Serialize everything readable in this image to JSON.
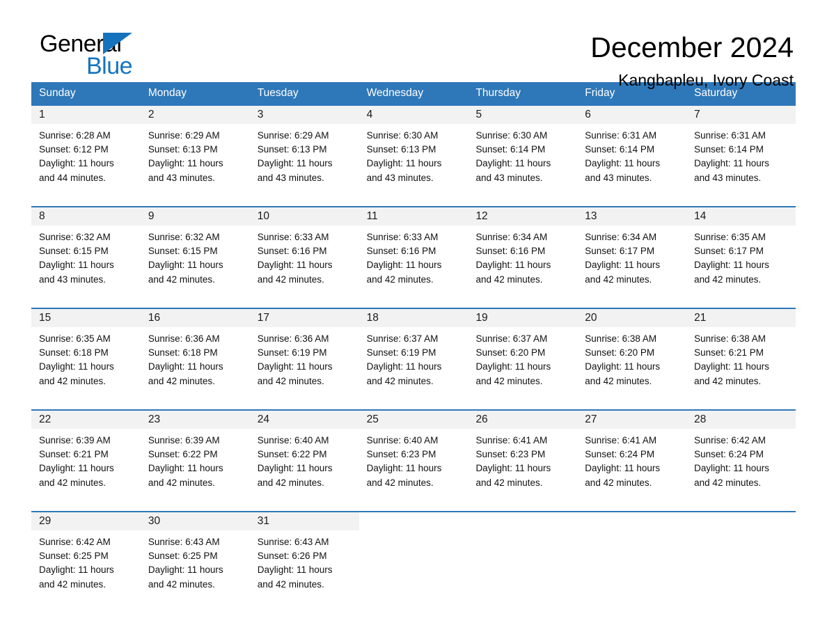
{
  "brand": {
    "name_part1": "General",
    "name_part2": "Blue",
    "accent_color": "#1573bd",
    "triangle_icon": "triangle-icon"
  },
  "header": {
    "month_title": "December 2024",
    "location": "Kangbapleu, Ivory Coast"
  },
  "calendar": {
    "header_color": "#2e77b8",
    "weekday_band_color": "#f2f2f2",
    "weekdays": [
      "Sunday",
      "Monday",
      "Tuesday",
      "Wednesday",
      "Thursday",
      "Friday",
      "Saturday"
    ],
    "weeks": [
      {
        "days": [
          {
            "num": "1",
            "text": "Sunrise: 6:28 AM\nSunset: 6:12 PM\nDaylight: 11 hours\nand 44 minutes."
          },
          {
            "num": "2",
            "text": "Sunrise: 6:29 AM\nSunset: 6:13 PM\nDaylight: 11 hours\nand 43 minutes."
          },
          {
            "num": "3",
            "text": "Sunrise: 6:29 AM\nSunset: 6:13 PM\nDaylight: 11 hours\nand 43 minutes."
          },
          {
            "num": "4",
            "text": "Sunrise: 6:30 AM\nSunset: 6:13 PM\nDaylight: 11 hours\nand 43 minutes."
          },
          {
            "num": "5",
            "text": "Sunrise: 6:30 AM\nSunset: 6:14 PM\nDaylight: 11 hours\nand 43 minutes."
          },
          {
            "num": "6",
            "text": "Sunrise: 6:31 AM\nSunset: 6:14 PM\nDaylight: 11 hours\nand 43 minutes."
          },
          {
            "num": "7",
            "text": "Sunrise: 6:31 AM\nSunset: 6:14 PM\nDaylight: 11 hours\nand 43 minutes."
          }
        ]
      },
      {
        "days": [
          {
            "num": "8",
            "text": "Sunrise: 6:32 AM\nSunset: 6:15 PM\nDaylight: 11 hours\nand 43 minutes."
          },
          {
            "num": "9",
            "text": "Sunrise: 6:32 AM\nSunset: 6:15 PM\nDaylight: 11 hours\nand 42 minutes."
          },
          {
            "num": "10",
            "text": "Sunrise: 6:33 AM\nSunset: 6:16 PM\nDaylight: 11 hours\nand 42 minutes."
          },
          {
            "num": "11",
            "text": "Sunrise: 6:33 AM\nSunset: 6:16 PM\nDaylight: 11 hours\nand 42 minutes."
          },
          {
            "num": "12",
            "text": "Sunrise: 6:34 AM\nSunset: 6:16 PM\nDaylight: 11 hours\nand 42 minutes."
          },
          {
            "num": "13",
            "text": "Sunrise: 6:34 AM\nSunset: 6:17 PM\nDaylight: 11 hours\nand 42 minutes."
          },
          {
            "num": "14",
            "text": "Sunrise: 6:35 AM\nSunset: 6:17 PM\nDaylight: 11 hours\nand 42 minutes."
          }
        ]
      },
      {
        "days": [
          {
            "num": "15",
            "text": "Sunrise: 6:35 AM\nSunset: 6:18 PM\nDaylight: 11 hours\nand 42 minutes."
          },
          {
            "num": "16",
            "text": "Sunrise: 6:36 AM\nSunset: 6:18 PM\nDaylight: 11 hours\nand 42 minutes."
          },
          {
            "num": "17",
            "text": "Sunrise: 6:36 AM\nSunset: 6:19 PM\nDaylight: 11 hours\nand 42 minutes."
          },
          {
            "num": "18",
            "text": "Sunrise: 6:37 AM\nSunset: 6:19 PM\nDaylight: 11 hours\nand 42 minutes."
          },
          {
            "num": "19",
            "text": "Sunrise: 6:37 AM\nSunset: 6:20 PM\nDaylight: 11 hours\nand 42 minutes."
          },
          {
            "num": "20",
            "text": "Sunrise: 6:38 AM\nSunset: 6:20 PM\nDaylight: 11 hours\nand 42 minutes."
          },
          {
            "num": "21",
            "text": "Sunrise: 6:38 AM\nSunset: 6:21 PM\nDaylight: 11 hours\nand 42 minutes."
          }
        ]
      },
      {
        "days": [
          {
            "num": "22",
            "text": "Sunrise: 6:39 AM\nSunset: 6:21 PM\nDaylight: 11 hours\nand 42 minutes."
          },
          {
            "num": "23",
            "text": "Sunrise: 6:39 AM\nSunset: 6:22 PM\nDaylight: 11 hours\nand 42 minutes."
          },
          {
            "num": "24",
            "text": "Sunrise: 6:40 AM\nSunset: 6:22 PM\nDaylight: 11 hours\nand 42 minutes."
          },
          {
            "num": "25",
            "text": "Sunrise: 6:40 AM\nSunset: 6:23 PM\nDaylight: 11 hours\nand 42 minutes."
          },
          {
            "num": "26",
            "text": "Sunrise: 6:41 AM\nSunset: 6:23 PM\nDaylight: 11 hours\nand 42 minutes."
          },
          {
            "num": "27",
            "text": "Sunrise: 6:41 AM\nSunset: 6:24 PM\nDaylight: 11 hours\nand 42 minutes."
          },
          {
            "num": "28",
            "text": "Sunrise: 6:42 AM\nSunset: 6:24 PM\nDaylight: 11 hours\nand 42 minutes."
          }
        ]
      },
      {
        "days": [
          {
            "num": "29",
            "text": "Sunrise: 6:42 AM\nSunset: 6:25 PM\nDaylight: 11 hours\nand 42 minutes."
          },
          {
            "num": "30",
            "text": "Sunrise: 6:43 AM\nSunset: 6:25 PM\nDaylight: 11 hours\nand 42 minutes."
          },
          {
            "num": "31",
            "text": "Sunrise: 6:43 AM\nSunset: 6:26 PM\nDaylight: 11 hours\nand 42 minutes."
          },
          {
            "num": "",
            "text": ""
          },
          {
            "num": "",
            "text": ""
          },
          {
            "num": "",
            "text": ""
          },
          {
            "num": "",
            "text": ""
          }
        ]
      }
    ]
  }
}
